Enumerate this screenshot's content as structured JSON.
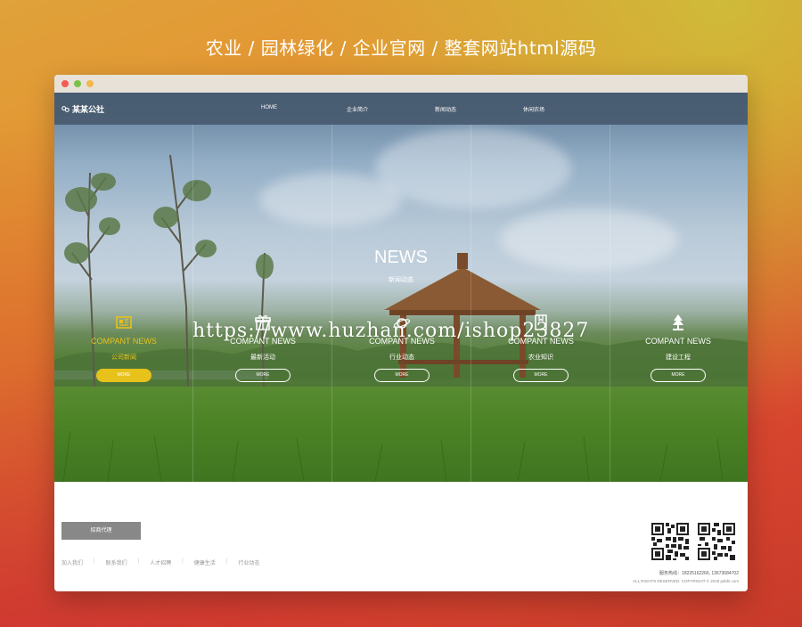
{
  "banner": {
    "title": "农业 / 园林绿化 / 企业官网 / 整套网站html源码"
  },
  "navbar": {
    "logo": "某某公社",
    "items": [
      {
        "label": "HOME"
      },
      {
        "label": "企业简介"
      },
      {
        "label": "新闻动态"
      },
      {
        "label": "休闲农场"
      }
    ]
  },
  "hero": {
    "title": "NEWS",
    "subtitle": "新闻动态",
    "watermark": "https://www.huzhan.com/ishop23827",
    "cards": [
      {
        "title": "COMPANT NEWS",
        "sub": "公司新闻",
        "button": "MORE",
        "icon": "newspaper-icon",
        "active": true
      },
      {
        "title": "COMPANT NEWS",
        "sub": "最新活动",
        "button": "MORE",
        "icon": "gift-icon",
        "active": false
      },
      {
        "title": "COMPANT NEWS",
        "sub": "行业动态",
        "button": "MORE",
        "icon": "planet-icon",
        "active": false
      },
      {
        "title": "COMPANT NEWS",
        "sub": "农业知识",
        "button": "MORE",
        "icon": "box-icon",
        "active": false
      },
      {
        "title": "COMPANT NEWS",
        "sub": "建设工程",
        "button": "MORE",
        "icon": "tree-icon",
        "active": false
      }
    ]
  },
  "footer": {
    "button": "招商代理",
    "links": [
      "加入我们",
      "联系我们",
      "人才招聘",
      "健康生活",
      "行业动态"
    ],
    "phone": "服务热线：18225162266, 13673684702",
    "copyright": "ALL RIGHTS RESERVED. COPYRIGHT © 2018 pdshi.com"
  },
  "colors": {
    "accent": "#e7c21a",
    "navbar": "#46586c"
  }
}
